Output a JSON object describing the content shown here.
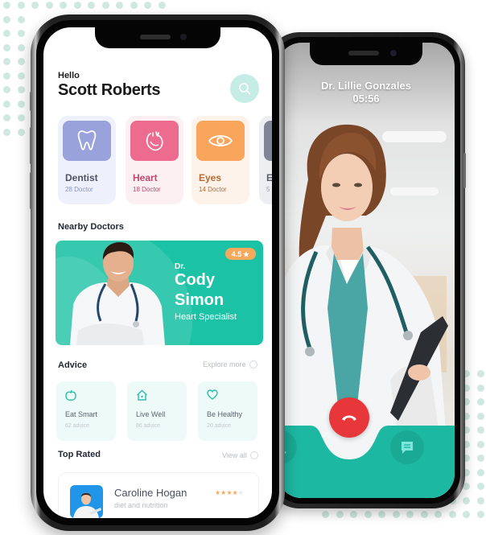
{
  "home_app": {
    "greeting": "Hello",
    "user_name": "Scott Roberts",
    "search_icon": "search-icon",
    "categories": [
      {
        "title": "Dentist",
        "subtitle": "28 Doctor",
        "icon": "tooth-icon",
        "tile_color": "#9aa2dc",
        "card_bg": "#eef1fb",
        "title_color": "#4e5365",
        "sub_color": "#8a93d0"
      },
      {
        "title": "Heart",
        "subtitle": "18 Doctor",
        "icon": "heart-organ-icon",
        "tile_color": "#ee6b90",
        "card_bg": "#fdf0f2",
        "title_color": "#c2476a",
        "sub_color": "#c2476a"
      },
      {
        "title": "Eyes",
        "subtitle": "14 Doctor",
        "icon": "eye-icon",
        "tile_color": "#f9a55c",
        "card_bg": "#fef3ea",
        "title_color": "#bb6a32",
        "sub_color": "#bb6a32"
      },
      {
        "title": "E",
        "subtitle": "5",
        "icon": "category-icon",
        "tile_color": "#7f8496",
        "card_bg": "#eceef1",
        "title_color": "#5a5f6e",
        "sub_color": "#9a9fac"
      }
    ],
    "nearby": {
      "section_title": "Nearby Doctors",
      "doctor_prefix": "Dr.",
      "doctor_first": "Cody",
      "doctor_last": "Simon",
      "specialty": "Heart Specialist",
      "rating": "4.5",
      "rating_icon": "star-icon",
      "accent": "#1bc2a6"
    },
    "advice": {
      "section_title": "Advice",
      "link_label": "Explore more",
      "items": [
        {
          "title": "Eat Smart",
          "subtitle": "62 advice",
          "icon": "apple-icon"
        },
        {
          "title": "Live Well",
          "subtitle": "86 advice",
          "icon": "house-icon"
        },
        {
          "title": "Be Healthy",
          "subtitle": "20 advice",
          "icon": "heart-icon"
        }
      ]
    },
    "top_rated": {
      "section_title": "Top Rated",
      "link_label": "View all",
      "items": [
        {
          "name": "Caroline Hogan",
          "subtitle": "diet and nutrition",
          "stars": 4,
          "max_stars": 5
        }
      ]
    }
  },
  "call_app": {
    "caller_name": "Dr. Lillie Gonzales",
    "call_duration": "05:56",
    "end_call_icon": "phone-hangup-icon",
    "mute_icon": "mic-off-icon",
    "chat_icon": "chat-icon",
    "end_call_color": "#e8373b",
    "bar_color": "#1db8a2"
  }
}
